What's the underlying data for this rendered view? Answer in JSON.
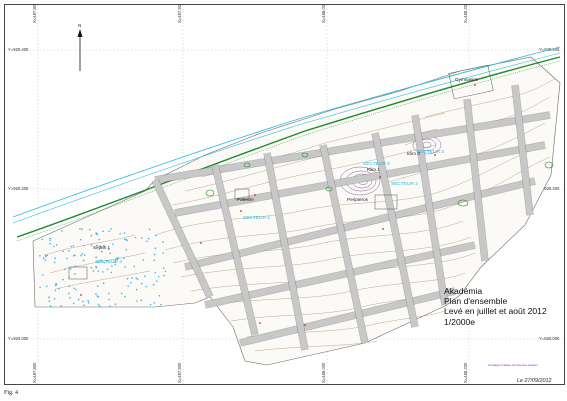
{
  "figure_label": "Fig. 4",
  "title_block": {
    "site": "Akadémia",
    "plan": "Plan d'ensemble",
    "survey": "Levé en juillet et août 2012",
    "scale": "1/2000e"
  },
  "date": "Le 27/09/2012",
  "legend_note": "Sondages réalisés par diverses équipes",
  "north_label": "N",
  "grid": {
    "x_labels": [
      "X=487.800",
      "X=487.900",
      "X=488.000",
      "X=488.200"
    ],
    "y_labels": [
      "Y=920.400",
      "Y=920.200",
      "Y=920.000"
    ]
  },
  "features": {
    "peripteros": "Peripteros",
    "klim1": "Klim 1",
    "klim3": "Klim 3",
    "sepuh": "Sepuh 1",
    "gymnase": "Gymnasion",
    "palestre": "Palestre"
  },
  "sectors": [
    "SECTEUR 1",
    "SECTEUR 2",
    "SECTEUR 3",
    "SECTEUR 4",
    "SECTEUR 5"
  ],
  "colors": {
    "contour": "#9c6b47",
    "road": "#c8c8c8",
    "road_edge": "#7a7a7a",
    "river": "#2fbde0",
    "vegetation": "#1f8a2a",
    "points": "#3ab4e8",
    "sector": "#2bb7d6",
    "archaeo": "#7a2fb8",
    "survey_red": "#d12a2a"
  }
}
